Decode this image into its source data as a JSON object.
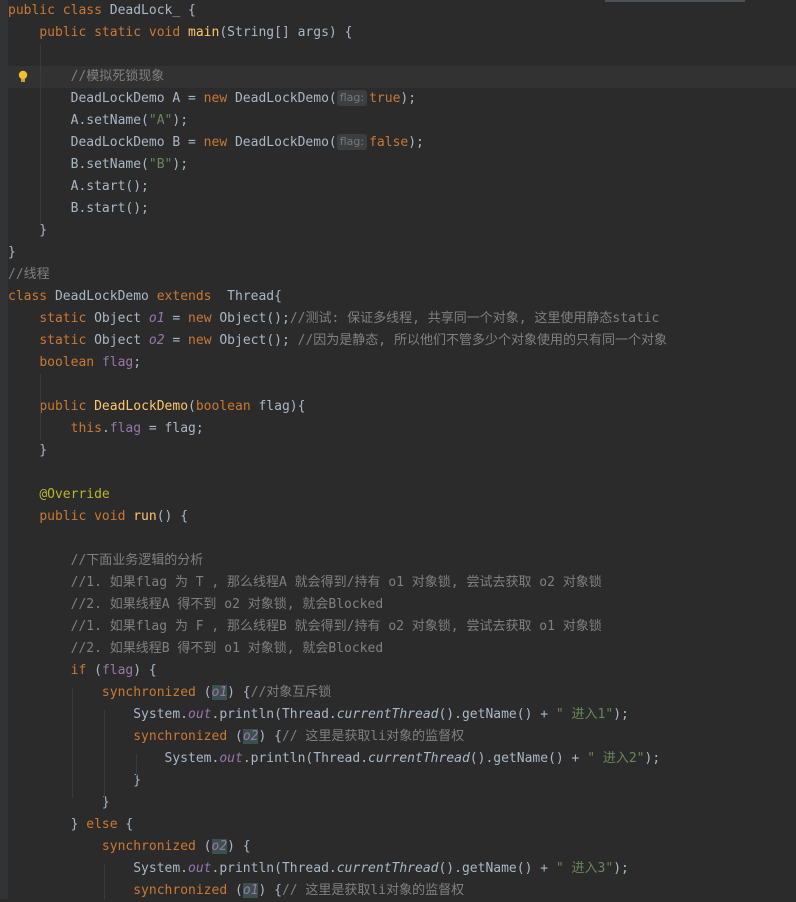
{
  "editor": {
    "lines": [
      [
        [
          "kw",
          "public class "
        ],
        [
          "plain",
          "DeadLock_ {"
        ]
      ],
      [
        [
          "plain",
          "    "
        ],
        [
          "kw",
          "public static void "
        ],
        [
          "fn",
          "main"
        ],
        [
          "plain",
          "(String[] args) {"
        ]
      ],
      [],
      [
        [
          "plain",
          "        "
        ],
        [
          "cm",
          "//模拟死锁现象"
        ]
      ],
      [
        [
          "plain",
          "        DeadLockDemo A = "
        ],
        [
          "kw",
          "new "
        ],
        [
          "plain",
          "DeadLockDemo("
        ],
        [
          "hint",
          "flag:"
        ],
        [
          "kw",
          "true"
        ],
        [
          "plain",
          ");"
        ]
      ],
      [
        [
          "plain",
          "        A.setName("
        ],
        [
          "str",
          "\"A\""
        ],
        [
          "plain",
          ");"
        ]
      ],
      [
        [
          "plain",
          "        DeadLockDemo B = "
        ],
        [
          "kw",
          "new "
        ],
        [
          "plain",
          "DeadLockDemo("
        ],
        [
          "hint",
          "flag:"
        ],
        [
          "kw",
          "false"
        ],
        [
          "plain",
          ");"
        ]
      ],
      [
        [
          "plain",
          "        B.setName("
        ],
        [
          "str",
          "\"B\""
        ],
        [
          "plain",
          ");"
        ]
      ],
      [
        [
          "plain",
          "        A.start();"
        ]
      ],
      [
        [
          "plain",
          "        B.start();"
        ]
      ],
      [
        [
          "plain",
          "    }"
        ]
      ],
      [
        [
          "plain",
          "}"
        ]
      ],
      [
        [
          "cm",
          "//线程"
        ]
      ],
      [
        [
          "kw",
          "class "
        ],
        [
          "plain",
          "DeadLockDemo "
        ],
        [
          "kw",
          "extends  "
        ],
        [
          "plain",
          "Thread{"
        ]
      ],
      [
        [
          "plain",
          "    "
        ],
        [
          "kw",
          "static "
        ],
        [
          "plain",
          "Object "
        ],
        [
          "static-field",
          "o1"
        ],
        [
          "plain",
          " = "
        ],
        [
          "kw",
          "new "
        ],
        [
          "plain",
          "Object();"
        ],
        [
          "cm",
          "//测试: 保证多线程, 共享同一个对象, 这里使用静态static"
        ]
      ],
      [
        [
          "plain",
          "    "
        ],
        [
          "kw",
          "static "
        ],
        [
          "plain",
          "Object "
        ],
        [
          "static-field",
          "o2"
        ],
        [
          "plain",
          " = "
        ],
        [
          "kw",
          "new "
        ],
        [
          "plain",
          "Object(); "
        ],
        [
          "cm",
          "//因为是静态, 所以他们不管多少个对象使用的只有同一个对象"
        ]
      ],
      [
        [
          "plain",
          "    "
        ],
        [
          "kw",
          "boolean "
        ],
        [
          "field",
          "flag"
        ],
        [
          "plain",
          ";"
        ]
      ],
      [],
      [
        [
          "plain",
          "    "
        ],
        [
          "kw",
          "public "
        ],
        [
          "fn",
          "DeadLockDemo"
        ],
        [
          "plain",
          "("
        ],
        [
          "kw",
          "boolean "
        ],
        [
          "plain",
          "flag){"
        ]
      ],
      [
        [
          "plain",
          "        "
        ],
        [
          "kw",
          "this"
        ],
        [
          "plain",
          "."
        ],
        [
          "field",
          "flag"
        ],
        [
          "plain",
          " = flag;"
        ]
      ],
      [
        [
          "plain",
          "    }"
        ]
      ],
      [],
      [
        [
          "plain",
          "    "
        ],
        [
          "ann",
          "@Override"
        ]
      ],
      [
        [
          "plain",
          "    "
        ],
        [
          "kw",
          "public void "
        ],
        [
          "fn",
          "run"
        ],
        [
          "plain",
          "() {"
        ]
      ],
      [],
      [
        [
          "plain",
          "        "
        ],
        [
          "cm",
          "//下面业务逻辑的分析"
        ]
      ],
      [
        [
          "plain",
          "        "
        ],
        [
          "cm",
          "//1. 如果flag 为 T , 那么线程A 就会得到/持有 o1 对象锁, 尝试去获取 o2 对象锁"
        ]
      ],
      [
        [
          "plain",
          "        "
        ],
        [
          "cm",
          "//2. 如果线程A 得不到 o2 对象锁, 就会Blocked"
        ]
      ],
      [
        [
          "plain",
          "        "
        ],
        [
          "cm",
          "//1. 如果flag 为 F , 那么线程B 就会得到/持有 o2 对象锁, 尝试去获取 o1 对象锁"
        ]
      ],
      [
        [
          "plain",
          "        "
        ],
        [
          "cm",
          "//2. 如果线程B 得不到 o1 对象锁, 就会Blocked"
        ]
      ],
      [
        [
          "plain",
          "        "
        ],
        [
          "kw",
          "if "
        ],
        [
          "plain",
          "("
        ],
        [
          "field",
          "flag"
        ],
        [
          "plain",
          ") {"
        ]
      ],
      [
        [
          "plain",
          "            "
        ],
        [
          "kw",
          "synchronized "
        ],
        [
          "plain",
          "("
        ],
        [
          "mark-sf",
          "o1"
        ],
        [
          "plain",
          ") {"
        ],
        [
          "cm",
          "//对象互斥锁"
        ]
      ],
      [
        [
          "plain",
          "                System."
        ],
        [
          "static-field",
          "out"
        ],
        [
          "plain",
          ".println(Thread."
        ],
        [
          "static-call",
          "currentThread"
        ],
        [
          "plain",
          "().getName() + "
        ],
        [
          "str",
          "\" 进入1\""
        ],
        [
          "plain",
          ");"
        ]
      ],
      [
        [
          "plain",
          "                "
        ],
        [
          "kw",
          "synchronized "
        ],
        [
          "plain",
          "("
        ],
        [
          "mark-sf",
          "o2"
        ],
        [
          "plain",
          ") {"
        ],
        [
          "cm",
          "// 这里是获取li对象的监督权"
        ]
      ],
      [
        [
          "plain",
          "                    System."
        ],
        [
          "static-field",
          "out"
        ],
        [
          "plain",
          ".println(Thread."
        ],
        [
          "static-call",
          "currentThread"
        ],
        [
          "plain",
          "().getName() + "
        ],
        [
          "str",
          "\" 进入2\""
        ],
        [
          "plain",
          ");"
        ]
      ],
      [
        [
          "plain",
          "                }"
        ]
      ],
      [
        [
          "plain",
          "            }"
        ]
      ],
      [
        [
          "plain",
          "        } "
        ],
        [
          "kw",
          "else "
        ],
        [
          "plain",
          "{"
        ]
      ],
      [
        [
          "plain",
          "            "
        ],
        [
          "kw",
          "synchronized "
        ],
        [
          "plain",
          "("
        ],
        [
          "mark-sf",
          "o2"
        ],
        [
          "plain",
          ") {"
        ]
      ],
      [
        [
          "plain",
          "                System."
        ],
        [
          "static-field",
          "out"
        ],
        [
          "plain",
          ".println(Thread."
        ],
        [
          "static-call",
          "currentThread"
        ],
        [
          "plain",
          "().getName() + "
        ],
        [
          "str",
          "\" 进入3\""
        ],
        [
          "plain",
          ");"
        ]
      ],
      [
        [
          "plain",
          "                "
        ],
        [
          "kw",
          "synchronized "
        ],
        [
          "plain",
          "("
        ],
        [
          "mark-sf",
          "o1"
        ],
        [
          "plain",
          ") {"
        ],
        [
          "cm",
          "// 这里是获取li对象的监督权"
        ]
      ]
    ],
    "highlighted_line": 3,
    "colors": {
      "background": "#2b2b2b",
      "keyword": "#cc7832",
      "function": "#ffc66d",
      "string": "#6a8759",
      "comment": "#808080",
      "field": "#9876aa",
      "annotation": "#bbb529",
      "text": "#a9b7c6"
    },
    "icons": {
      "line_3": "lightbulb-icon"
    }
  }
}
